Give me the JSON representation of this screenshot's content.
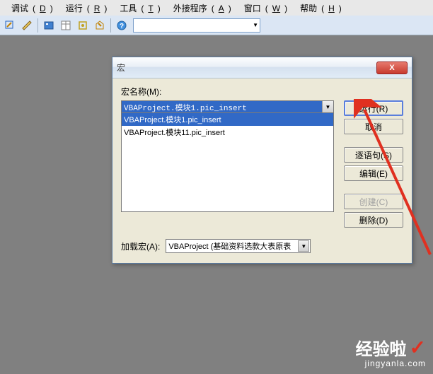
{
  "menubar": {
    "items": [
      {
        "label": "调试",
        "key": "D"
      },
      {
        "label": "运行",
        "key": "R"
      },
      {
        "label": "工具",
        "key": "T"
      },
      {
        "label": "外接程序",
        "key": "A"
      },
      {
        "label": "窗口",
        "key": "W"
      },
      {
        "label": "帮助",
        "key": "H"
      }
    ]
  },
  "toolbar": {
    "dropdown_value": ""
  },
  "dialog": {
    "title": "宏",
    "close": "X",
    "macro_name_label": "宏名称(M):",
    "selected_macro": "VBAProject.模块1.pic_insert",
    "list": [
      {
        "text": "VBAProject.模块1.pic_insert",
        "selected": true
      },
      {
        "text": "VBAProject.模块11.pic_insert",
        "selected": false
      }
    ],
    "buttons": {
      "run": "运行(R)",
      "cancel": "取消",
      "step": "逐语句(S)",
      "edit": "编辑(E)",
      "create": "创建(C)",
      "delete": "删除(D)"
    },
    "macro_in_label": "加载宏(A):",
    "macro_in_value": "VBAProject (基础资料选款大表原表"
  },
  "watermark": {
    "main": "经验啦",
    "sub": "jingyanla.com"
  }
}
